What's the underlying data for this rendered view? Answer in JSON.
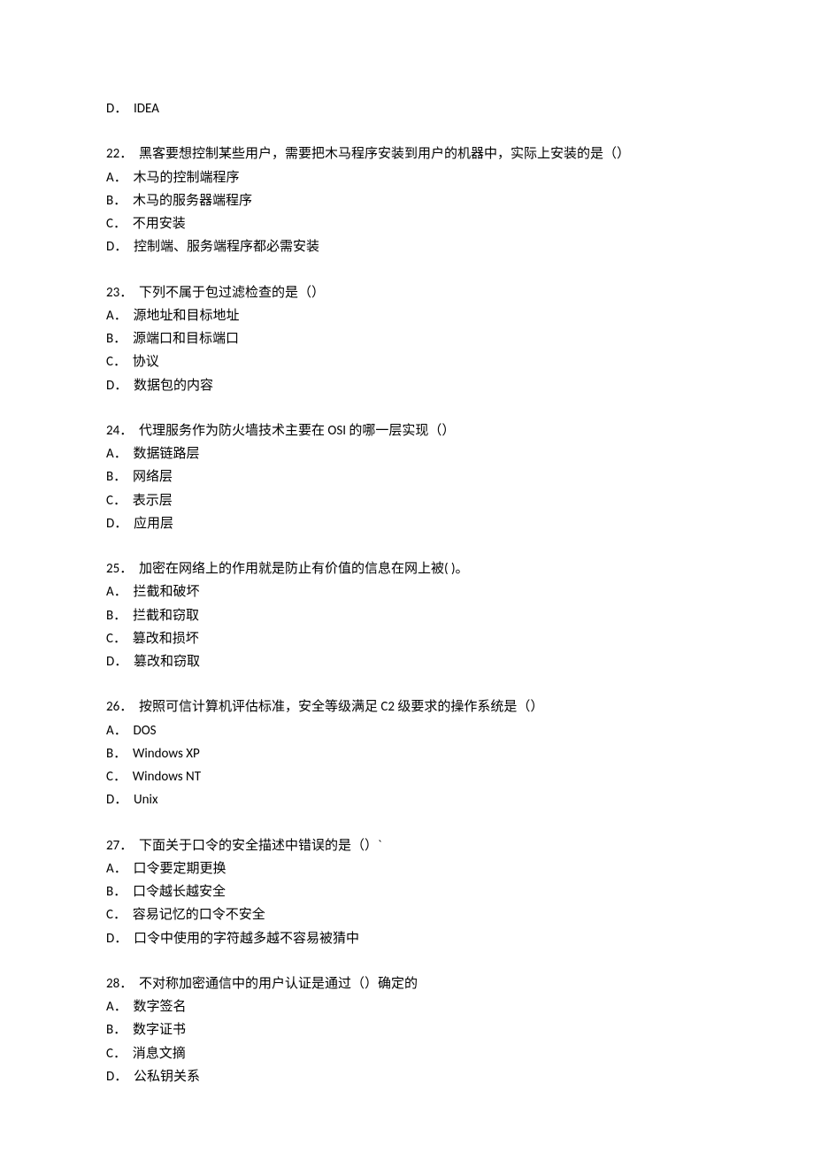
{
  "orphan": {
    "letter": "D",
    "text": "IDEA"
  },
  "questions": [
    {
      "num": "22",
      "stem": "黑客要想控制某些用户，需要把木马程序安装到用户的机器中，实际上安装的是（）",
      "opts": [
        {
          "l": "A",
          "t": "木马的控制端程序"
        },
        {
          "l": "B",
          "t": "木马的服务器端程序"
        },
        {
          "l": "C",
          "t": "不用安装"
        },
        {
          "l": "D",
          "t": "控制端、服务端程序都必需安装"
        }
      ]
    },
    {
      "num": "23",
      "stem": "下列不属于包过滤检查的是（）",
      "opts": [
        {
          "l": "A",
          "t": "源地址和目标地址"
        },
        {
          "l": "B",
          "t": "源端口和目标端口"
        },
        {
          "l": "C",
          "t": "协议"
        },
        {
          "l": "D",
          "t": "数据包的内容"
        }
      ]
    },
    {
      "num": "24",
      "stem": "代理服务作为防火墙技术主要在 OSI 的哪一层实现（）",
      "opts": [
        {
          "l": "A",
          "t": "数据链路层"
        },
        {
          "l": "B",
          "t": "网络层"
        },
        {
          "l": "C",
          "t": "表示层"
        },
        {
          "l": "D",
          "t": "应用层"
        }
      ]
    },
    {
      "num": "25",
      "stem": "加密在网络上的作用就是防止有价值的信息在网上被( )。",
      "opts": [
        {
          "l": "A",
          "t": "拦截和破坏"
        },
        {
          "l": "B",
          "t": "拦截和窃取"
        },
        {
          "l": "C",
          "t": "篡改和损坏"
        },
        {
          "l": "D",
          "t": "篡改和窃取"
        }
      ]
    },
    {
      "num": "26",
      "stem": "按照可信计算机评估标准，安全等级满足 C2 级要求的操作系统是（）",
      "opts": [
        {
          "l": "A",
          "t": "DOS"
        },
        {
          "l": "B",
          "t": "Windows XP"
        },
        {
          "l": "C",
          "t": "Windows NT"
        },
        {
          "l": "D",
          "t": "Unix"
        }
      ]
    },
    {
      "num": "27",
      "stem": "下面关于口令的安全描述中错误的是（）`",
      "opts": [
        {
          "l": "A",
          "t": "口令要定期更换"
        },
        {
          "l": "B",
          "t": "口令越长越安全"
        },
        {
          "l": "C",
          "t": "容易记忆的口令不安全"
        },
        {
          "l": "D",
          "t": "口令中使用的字符越多越不容易被猜中"
        }
      ]
    },
    {
      "num": "28",
      "stem": "不对称加密通信中的用户认证是通过（）确定的",
      "opts": [
        {
          "l": "A",
          "t": "数字签名"
        },
        {
          "l": "B",
          "t": "数字证书"
        },
        {
          "l": "C",
          "t": "消息文摘"
        },
        {
          "l": "D",
          "t": "公私钥关系"
        }
      ]
    }
  ]
}
